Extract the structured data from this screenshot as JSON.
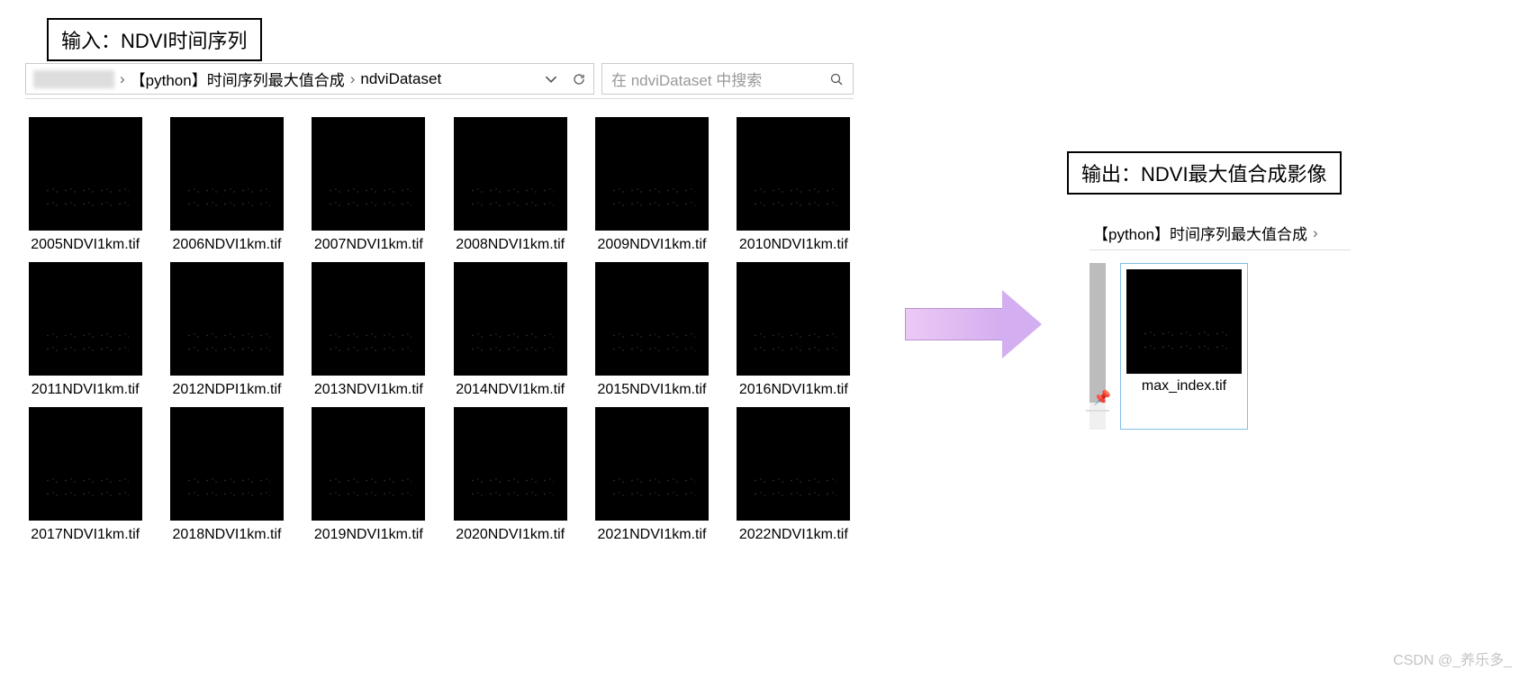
{
  "labels": {
    "input_title": "输入：NDVI时间序列",
    "output_title": "输出：NDVI最大值合成影像"
  },
  "left": {
    "path": {
      "seg1": "【python】时间序列最大值合成",
      "seg2": "ndviDataset"
    },
    "search_placeholder": "在 ndviDataset 中搜索",
    "files": [
      "2005NDVI1km.tif",
      "2006NDVI1km.tif",
      "2007NDVI1km.tif",
      "2008NDVI1km.tif",
      "2009NDVI1km.tif",
      "2010NDVI1km.tif",
      "2011NDVI1km.tif",
      "2012NDPI1km.tif",
      "2013NDVI1km.tif",
      "2014NDVI1km.tif",
      "2015NDVI1km.tif",
      "2016NDVI1km.tif",
      "2017NDVI1km.tif",
      "2018NDVI1km.tif",
      "2019NDVI1km.tif",
      "2020NDVI1km.tif",
      "2021NDVI1km.tif",
      "2022NDVI1km.tif"
    ]
  },
  "right": {
    "path_seg": "【python】时间序列最大值合成",
    "file": "max_index.tif"
  },
  "watermark": "CSDN @_养乐多_"
}
